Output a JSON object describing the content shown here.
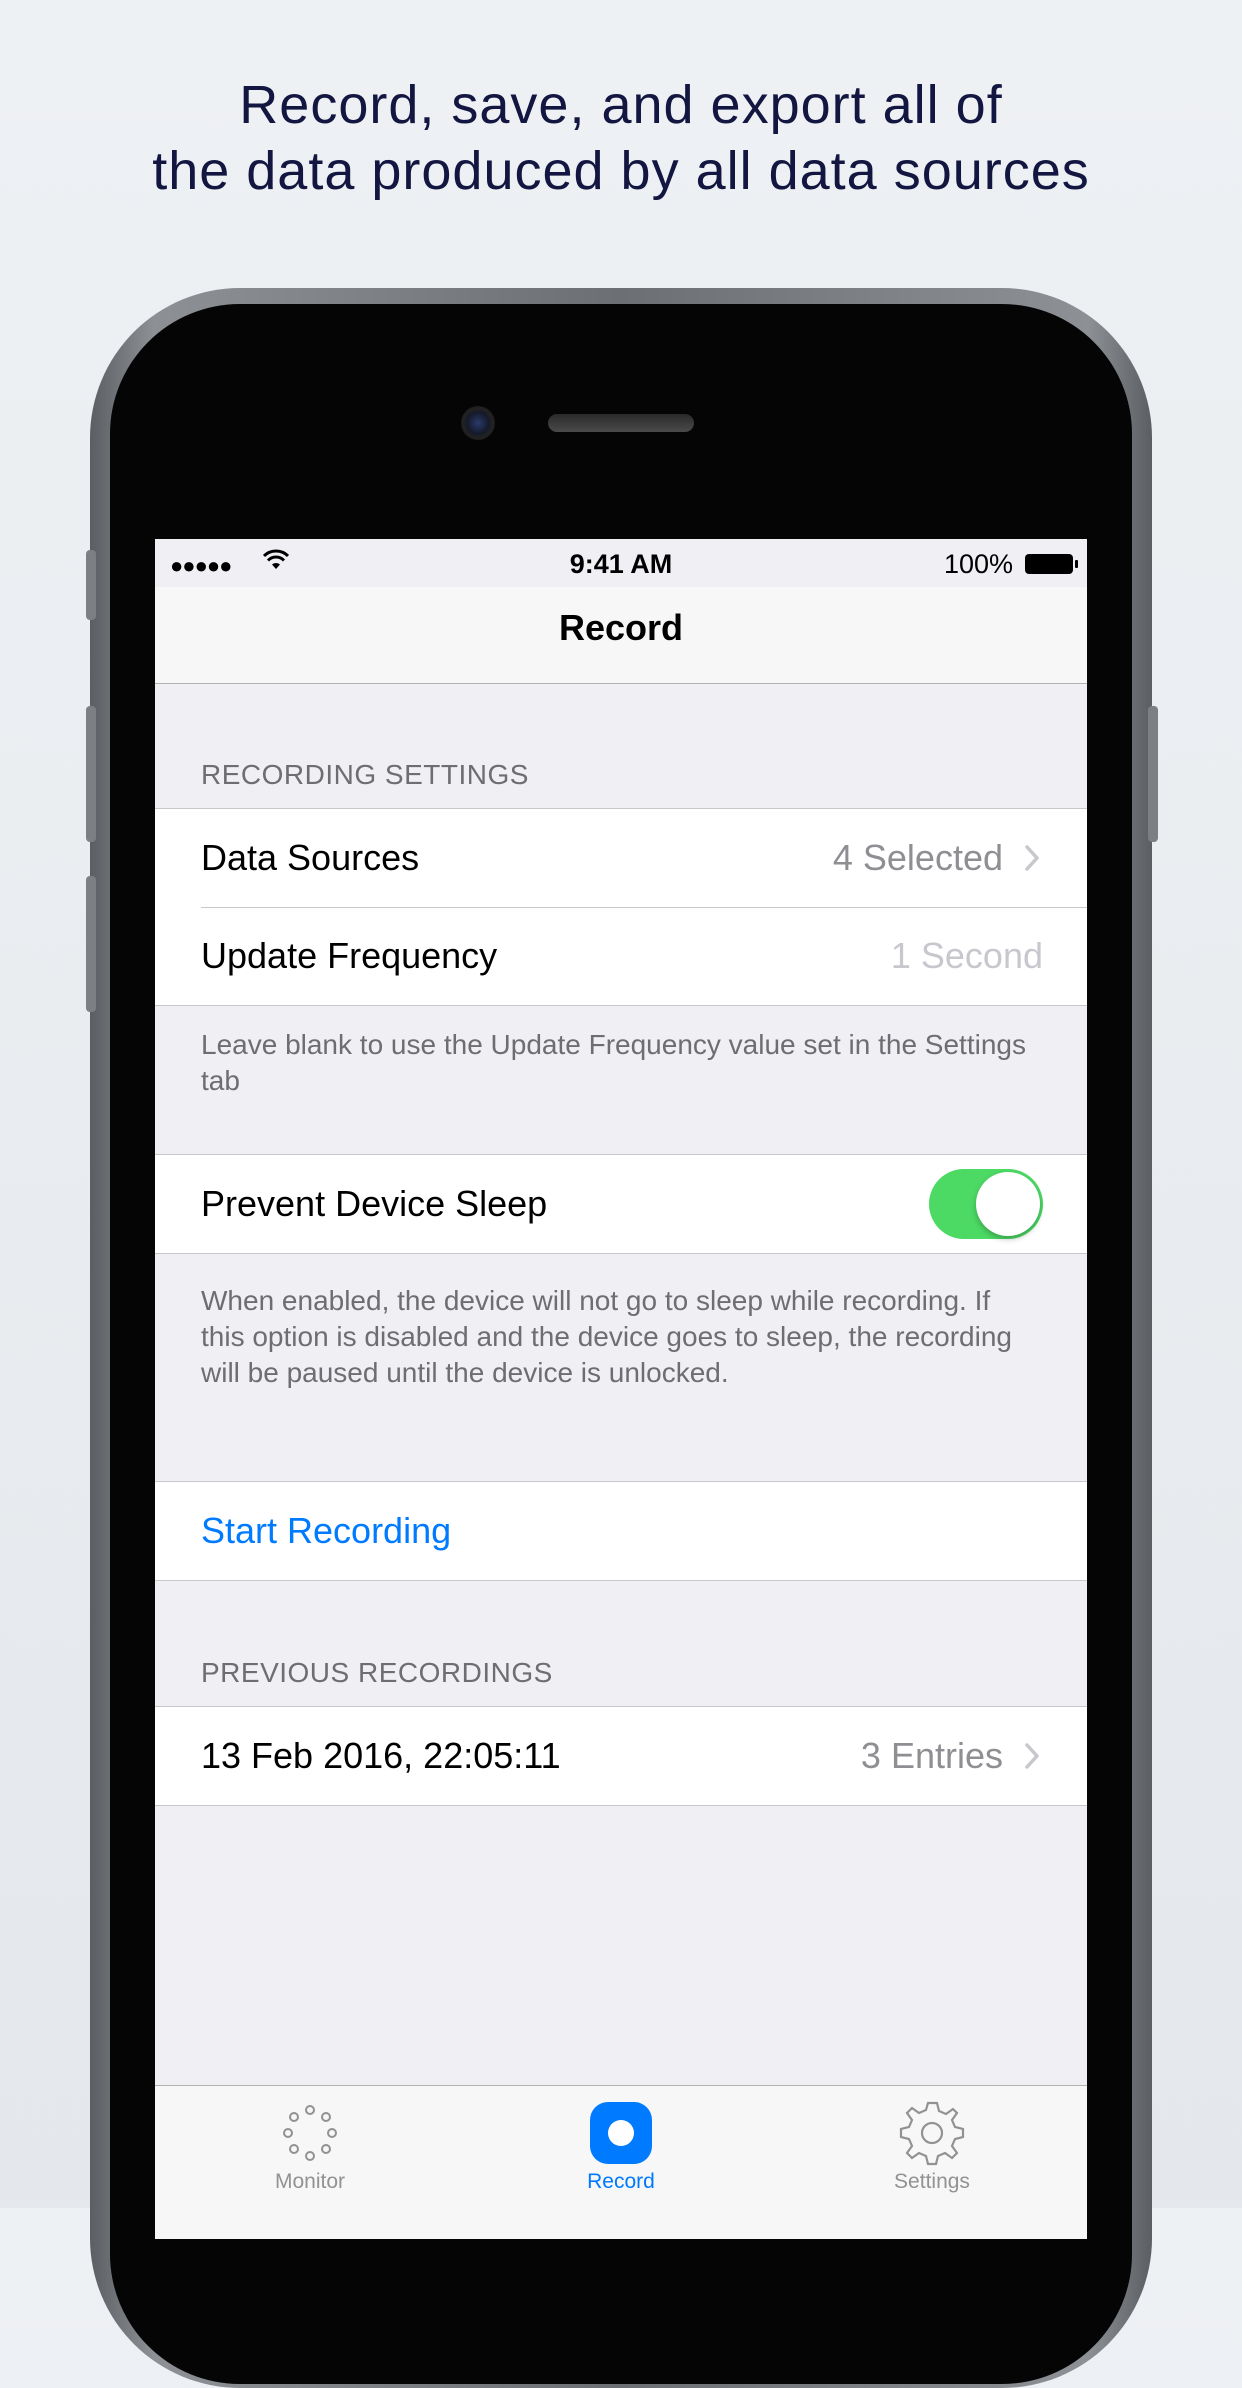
{
  "headline": {
    "line1": "Record, save, and export all of",
    "line2": "the data produced by all data sources"
  },
  "status_bar": {
    "signal": "●●●●●",
    "time": "9:41 AM",
    "battery": "100%"
  },
  "nav": {
    "title": "Record"
  },
  "recording_settings": {
    "header": "RECORDING SETTINGS",
    "data_sources": {
      "label": "Data Sources",
      "value": "4 Selected"
    },
    "update_frequency": {
      "label": "Update Frequency",
      "placeholder": "1 Second"
    },
    "footer": "Leave blank to use the Update Frequency value set in the Settings tab"
  },
  "prevent_sleep": {
    "label": "Prevent Device Sleep",
    "enabled": true,
    "footer": "When enabled, the device will not go to sleep while recording. If this option is disabled and the device goes to sleep, the recording will be paused until the device is unlocked."
  },
  "start_recording": {
    "label": "Start Recording"
  },
  "previous_recordings": {
    "header": "PREVIOUS RECORDINGS",
    "items": [
      {
        "date": "13 Feb 2016, 22:05:11",
        "entries": "3 Entries"
      }
    ]
  },
  "tabs": [
    {
      "label": "Monitor",
      "icon": "monitor-dots-icon",
      "active": false
    },
    {
      "label": "Record",
      "icon": "record-icon",
      "active": true
    },
    {
      "label": "Settings",
      "icon": "gear-icon",
      "active": false
    }
  ],
  "colors": {
    "accent": "#007aff",
    "toggle_on": "#4cd964",
    "headline": "#121640"
  }
}
